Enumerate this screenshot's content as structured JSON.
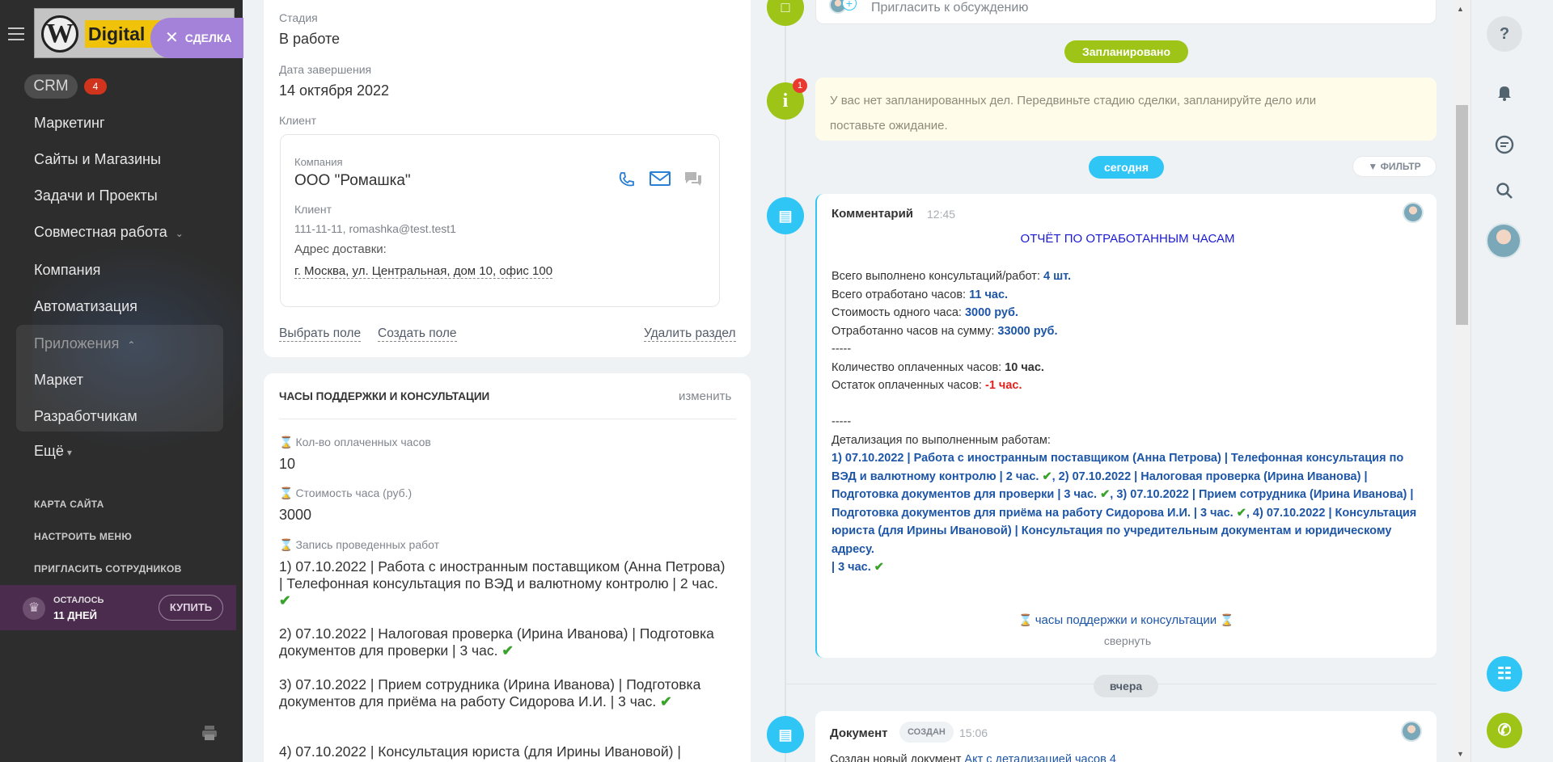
{
  "sidebar": {
    "logo_text": "Digital",
    "deal_close_label": "СДЕЛКА",
    "crm_label": "CRM",
    "crm_count": "4",
    "items": [
      {
        "label": "Маркетинг"
      },
      {
        "label": "Сайты и Магазины"
      },
      {
        "label": "Задачи и Проекты"
      },
      {
        "label": "Совместная работа"
      },
      {
        "label": "Компания"
      },
      {
        "label": "Автоматизация"
      },
      {
        "label": "Приложения"
      },
      {
        "label": "Маркет"
      },
      {
        "label": "Разработчикам"
      },
      {
        "label": "Ещё"
      }
    ],
    "links": [
      "КАРТА САЙТА",
      "НАСТРОИТЬ МЕНЮ",
      "ПРИГЛАСИТЬ СОТРУДНИКОВ"
    ],
    "trial_line1": "ОСТАЛОСЬ",
    "trial_line2": "11 ДНЕЙ",
    "buy_label": "КУПИТЬ"
  },
  "deal": {
    "stage_label": "Стадия",
    "stage_value": "В работе",
    "end_date_label": "Дата завершения",
    "end_date_value": "14 октября 2022",
    "client_label": "Клиент",
    "company_label": "Компания",
    "company_name": "ООО \"Ромашка\"",
    "client_sub_label": "Клиент",
    "client_contacts": "111-11-11, romashka@test.test1",
    "delivery_label": "Адрес доставки:",
    "delivery_address": "г. Москва, ул. Центральная, дом 10, офис 100",
    "select_field": "Выбрать поле",
    "create_field": "Создать поле",
    "delete_section": "Удалить раздел"
  },
  "hours_section": {
    "title": "ЧАСЫ ПОДДЕРЖКИ И КОНСУЛЬТАЦИИ",
    "edit_label": "изменить",
    "paid_hours_label": "Кол-во оплаченных часов",
    "paid_hours_value": "10",
    "rate_label": "Стоимость часа (руб.)",
    "rate_value": "3000",
    "works_label": "Запись проведенных работ",
    "works": [
      "1) 07.10.2022 | Работа с иностранным поставщиком (Анна Петрова) | Телефонная консультация по ВЭД и валютному контролю | 2 час.",
      "2) 07.10.2022 | Налоговая проверка (Ирина Иванова) | Подготовка документов для проверки | 3 час.",
      "3) 07.10.2022 | Прием сотрудника (Ирина Иванова) | Подготовка документов для приёма на работу Сидорова И.И. | 3 час.",
      "4) 07.10.2022 | Консультация юриста (для Ирины Ивановой) |"
    ]
  },
  "timeline": {
    "invite_placeholder": "Пригласить к обсуждению",
    "planned_badge": "Запланировано",
    "info_count": "1",
    "info_text": "У вас нет запланированных дел. Передвиньте стадию сделки, запланируйте дело или поставьте ожидание.",
    "today_badge": "сегодня",
    "filter_label": "ФИЛЬТР",
    "comment": {
      "type": "Комментарий",
      "time": "12:45",
      "heading": "ОТЧЁТ ПО ОТРАБОТАННЫМ ЧАСАМ",
      "rows": [
        {
          "label": "Всего выполнено консультаций/работ: ",
          "value": "4 шт."
        },
        {
          "label": "Всего отработано часов: ",
          "value": "11 час."
        },
        {
          "label": "Стоимость одного часа: ",
          "value": "3000 руб."
        },
        {
          "label": "Отработанно часов на сумму: ",
          "value": "33000 руб."
        }
      ],
      "divider": "-----",
      "paid_label": "Количество оплаченных часов: ",
      "paid_value": "10 час.",
      "rest_label": "Остаток оплаченных часов: ",
      "rest_value": "-1 час.",
      "divider2": "-----",
      "details_label": "Детализация по выполненным работам:",
      "details_1": "1) 07.10.2022 | Работа с иностранным поставщиком (Анна Петрова) | Телефонная консультация по ВЭД и валютному контролю | 2 час.",
      "details_2": ", 2) 07.10.2022 | Налоговая проверка (Ирина Иванова) | Подготовка документов для проверки | 3 час.",
      "details_3": ", 3) 07.10.2022 | Прием сотрудника (Ирина Иванова) | Подготовка документов для приёма на работу Сидорова И.И. | 3 час.",
      "details_4": ", 4) 07.10.2022 | Консультация юриста (для Ирины Ивановой) | Консультация по учредительным документам и юридическому адресу.",
      "details_5": "| 3 час.",
      "footer_link": "часы поддержки и консультации",
      "collapse": "свернуть"
    },
    "yesterday_badge": "вчера",
    "document": {
      "type": "Документ",
      "status": "СОЗДАН",
      "time": "15:06",
      "text": "Создан новый документ ",
      "link": "Акт с детализацией часов 4"
    }
  },
  "colors": {
    "sidebar_bg": "#2d2d2d",
    "accent_green": "#9dc417",
    "accent_blue": "#2fc6f6",
    "deal_purple": "#a582d9"
  }
}
